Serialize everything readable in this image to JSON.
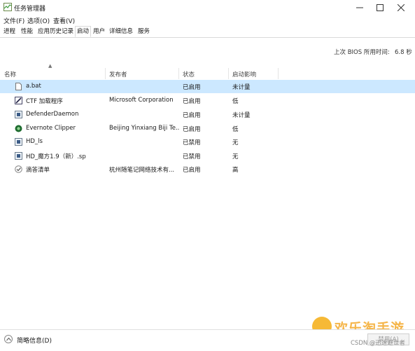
{
  "window": {
    "title": "任务管理器"
  },
  "menubar": {
    "items": [
      "文件(F)",
      "选项(O)",
      "查看(V)"
    ]
  },
  "tabs": [
    {
      "label": "进程",
      "active": false
    },
    {
      "label": "性能",
      "active": false
    },
    {
      "label": "应用历史记录",
      "active": false
    },
    {
      "label": "启动",
      "active": true
    },
    {
      "label": "用户",
      "active": false
    },
    {
      "label": "详细信息",
      "active": false
    },
    {
      "label": "服务",
      "active": false
    }
  ],
  "bios": {
    "label": "上次 BIOS 所用时间:",
    "value": "6.8 秒"
  },
  "columns": {
    "name": "名称",
    "publisher": "发布者",
    "status": "状态",
    "impact": "启动影响"
  },
  "rows": [
    {
      "name": "a.bat",
      "publisher": "",
      "status": "已启用",
      "impact": "未计量",
      "icon": "file-icon",
      "selected": true
    },
    {
      "name": "CTF 加载程序",
      "publisher": "Microsoft Corporation",
      "status": "已启用",
      "impact": "低",
      "icon": "pen-icon",
      "selected": false
    },
    {
      "name": "DefenderDaemon",
      "publisher": "",
      "status": "已启用",
      "impact": "未计量",
      "icon": "app-icon",
      "selected": false
    },
    {
      "name": "Evernote Clipper",
      "publisher": "Beijing Yinxiang Biji Te...",
      "status": "已启用",
      "impact": "低",
      "icon": "evernote-icon",
      "selected": false
    },
    {
      "name": "HD_ls",
      "publisher": "",
      "status": "已禁用",
      "impact": "无",
      "icon": "app-icon",
      "selected": false
    },
    {
      "name": "HD_魔方1.9（新）.sp",
      "publisher": "",
      "status": "已禁用",
      "impact": "无",
      "icon": "app-icon",
      "selected": false
    },
    {
      "name": "滴答清单",
      "publisher": "杭州随笔记网络技术有...",
      "status": "已启用",
      "impact": "高",
      "icon": "check-icon",
      "selected": false
    }
  ],
  "bottom": {
    "less_details": "简略信息(D)",
    "disable_button": "禁用(A)"
  },
  "watermark": {
    "text": "欢乐淘手游",
    "csdn": "CSDN @迅速避世者"
  },
  "colors": {
    "selected_row": "#cce8ff",
    "watermark": "#f4a92a"
  }
}
